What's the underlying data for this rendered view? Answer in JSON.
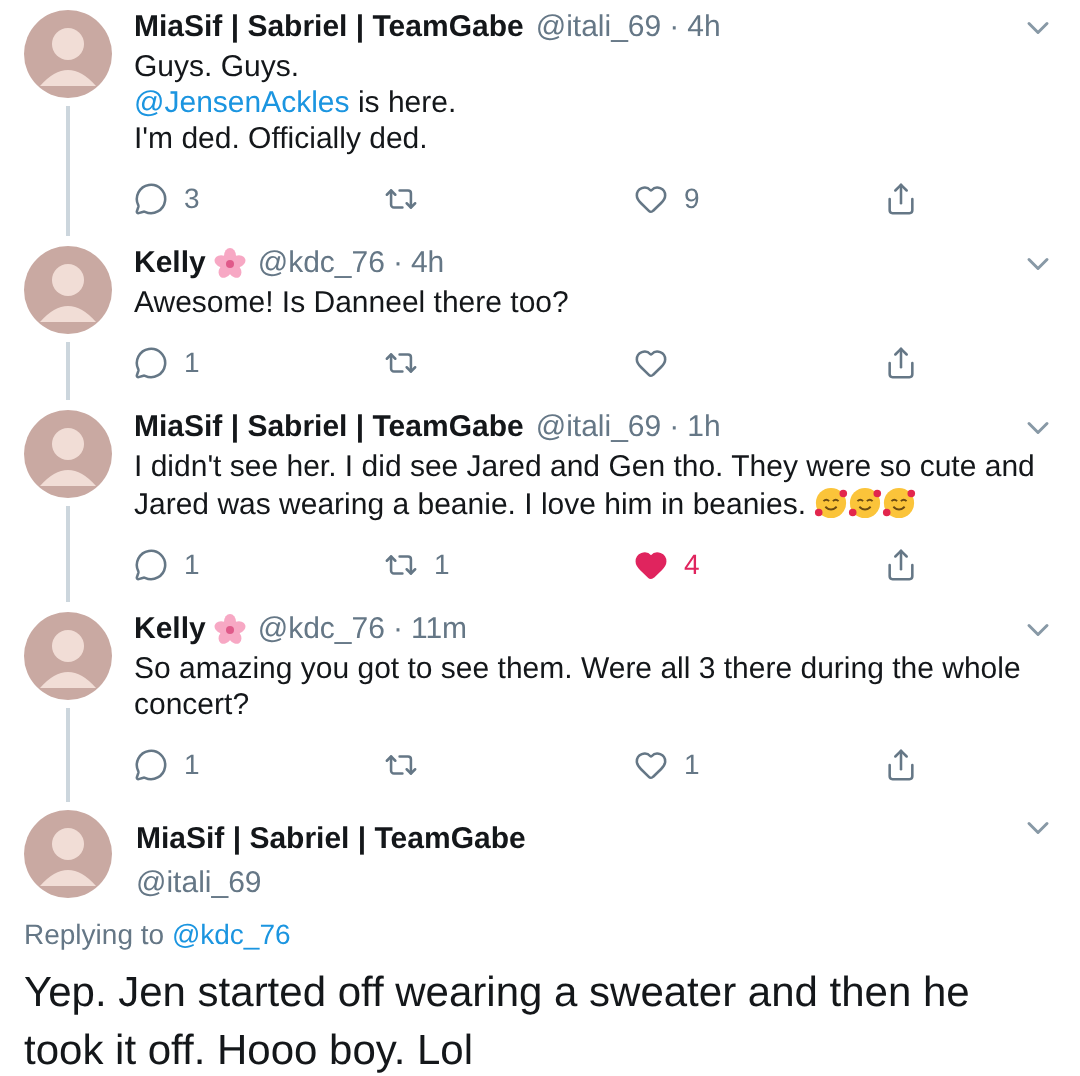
{
  "tweets": [
    {
      "kind": "thread",
      "name_parts": [
        {
          "kind": "text",
          "text": "MiaSif | Sabriel | TeamGabe"
        }
      ],
      "handle": "@itali_69",
      "separator": "·",
      "time": "4h",
      "thread_below": true,
      "lines": [
        [
          {
            "kind": "plain",
            "text": "Guys.  Guys."
          }
        ],
        [
          {
            "kind": "mention",
            "text": "@JensenAckles"
          },
          {
            "kind": "plain",
            "text": " is here."
          }
        ],
        [
          {
            "kind": "plain",
            "text": "I'm ded. Officially ded."
          }
        ]
      ],
      "replies": "3",
      "likes": "9",
      "liked": false
    },
    {
      "kind": "thread",
      "name_parts": [
        {
          "kind": "text",
          "text": "Kelly"
        },
        {
          "kind": "flower"
        }
      ],
      "handle": "@kdc_76",
      "separator": "·",
      "time": "4h",
      "thread_below": true,
      "lines": [
        [
          {
            "kind": "plain",
            "text": "Awesome!  Is Danneel there too?"
          }
        ]
      ],
      "replies": "1",
      "liked": false
    },
    {
      "kind": "thread",
      "name_parts": [
        {
          "kind": "text",
          "text": "MiaSif | Sabriel | TeamGabe"
        }
      ],
      "handle": "@itali_69",
      "separator": "·",
      "time": "1h",
      "thread_below": true,
      "lines": [
        [
          {
            "kind": "plain",
            "text": "I didn't see her. I did see Jared and Gen tho. They were so cute and Jared was wearing a beanie. I love him in beanies. "
          },
          {
            "kind": "emoji"
          },
          {
            "kind": "emoji"
          },
          {
            "kind": "emoji"
          }
        ]
      ],
      "replies": "1",
      "retweets": "1",
      "likes": "4",
      "liked": true
    },
    {
      "kind": "thread",
      "name_parts": [
        {
          "kind": "text",
          "text": "Kelly"
        },
        {
          "kind": "flower"
        }
      ],
      "handle": "@kdc_76",
      "separator": "·",
      "time": "11m",
      "thread_below": true,
      "lines": [
        [
          {
            "kind": "plain",
            "text": "So amazing you got to see them.  Were all 3 there during the whole concert?"
          }
        ]
      ],
      "replies": "1",
      "likes": "1",
      "liked": false
    },
    {
      "kind": "focus",
      "name_parts": [
        {
          "kind": "text",
          "text": "MiaSif | Sabriel | TeamGabe"
        }
      ],
      "handle": "@itali_69",
      "replying_label": "Replying to",
      "replying_to": "@kdc_76",
      "lines": [
        [
          {
            "kind": "plain",
            "text": "Yep. Jen started off wearing a sweater and then he took it off. Hooo boy. Lol"
          }
        ]
      ]
    }
  ]
}
